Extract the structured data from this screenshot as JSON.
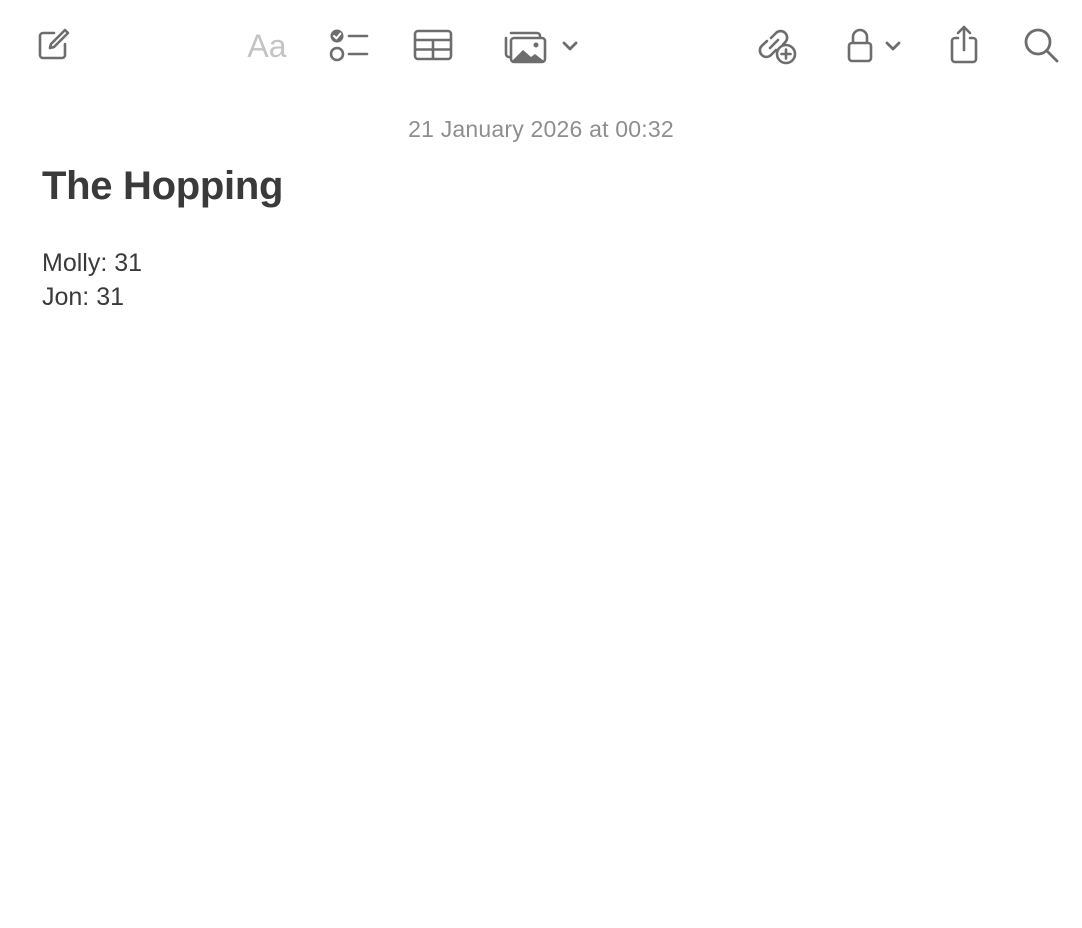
{
  "toolbar": {
    "format_label": "Aa",
    "icons": [
      "compose-icon",
      "checklist-icon",
      "table-icon",
      "media-icon",
      "collaborate-icon",
      "lock-icon",
      "share-icon",
      "search-icon"
    ]
  },
  "note": {
    "date": "21 January 2026 at 00:32",
    "title": "The Hopping",
    "lines": [
      "Molly: 31",
      "Jon: 31"
    ]
  },
  "colors": {
    "icon": "#6d6d6d",
    "text": "#3a3a3a",
    "date": "#8e8e8e",
    "disabled": "#c4c4c4"
  }
}
